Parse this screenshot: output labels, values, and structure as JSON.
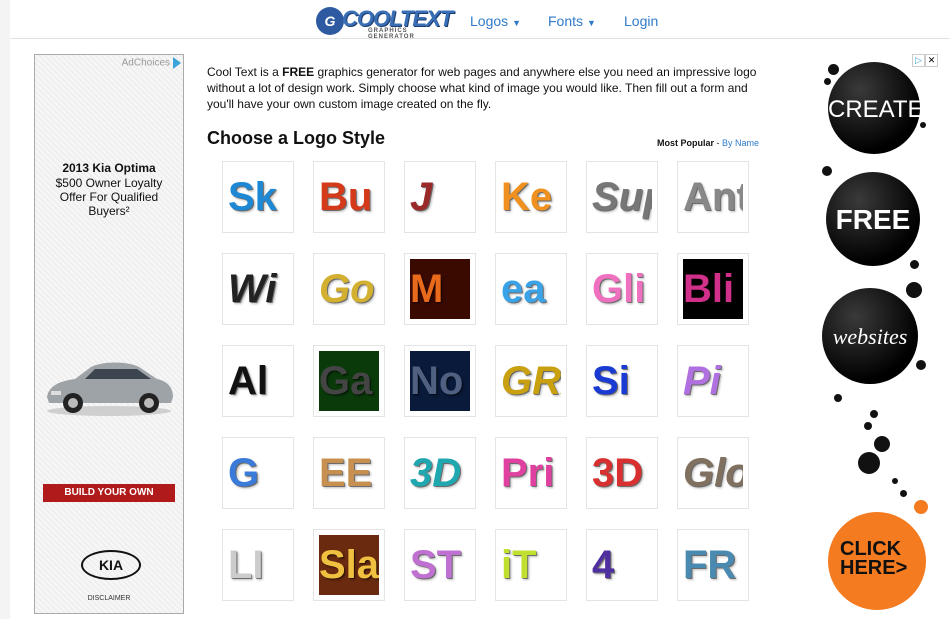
{
  "header": {
    "logo_text": "COOLTEXT",
    "logo_sub": "GRAPHICS GENERATOR",
    "logo_mark": "G",
    "nav": [
      {
        "label": "Logos",
        "dropdown": true
      },
      {
        "label": "Fonts",
        "dropdown": true
      },
      {
        "label": "Login",
        "dropdown": false
      }
    ]
  },
  "left_ad": {
    "adchoices": "AdChoices",
    "title": "2013 Kia Optima",
    "body_lines": [
      "$500 Owner Loyalty",
      "Offer For Qualified",
      "Buyers²"
    ],
    "button": "BUILD YOUR OWN",
    "brand": "KIA",
    "disclaimer": "DISCLAIMER"
  },
  "intro": {
    "before": "Cool Text is a ",
    "bold": "FREE",
    "after": " graphics generator for web pages and anywhere else you need an impressive logo without a lot of design work.  Simply choose what kind of image you would like. Then fill out a form and you'll have your own custom image created on the fly."
  },
  "section": {
    "title": "Choose a Logo Style",
    "sort_label": "Most Popular",
    "sort_sep": " - ",
    "sort_link": "By Name"
  },
  "logo_styles": [
    {
      "text": "Sk",
      "color": "#1e88d4",
      "bg": "#ffffff",
      "italic": false
    },
    {
      "text": "Bu",
      "color": "#d43a1a",
      "bg": "#ffffff",
      "italic": false
    },
    {
      "text": "J",
      "color": "#9a2a2a",
      "bg": "#ffffff",
      "italic": true
    },
    {
      "text": "Ke",
      "color": "#f0901e",
      "bg": "#ffffff",
      "italic": false
    },
    {
      "text": "Super",
      "color": "#777777",
      "bg": "#ffffff",
      "italic": true
    },
    {
      "text": "Ant",
      "color": "#888888",
      "bg": "#ffffff",
      "italic": false
    },
    {
      "text": "Wi",
      "color": "#222222",
      "bg": "#ffffff",
      "italic": true
    },
    {
      "text": "Go",
      "color": "#d4b030",
      "bg": "#ffffff",
      "italic": true
    },
    {
      "text": "M",
      "color": "#e86a1a",
      "bg": "#3a0a00",
      "italic": false
    },
    {
      "text": "ea",
      "color": "#3aa3e8",
      "bg": "#ffffff",
      "italic": false
    },
    {
      "text": "Gli",
      "color": "#f070c0",
      "bg": "#ffffff",
      "italic": false
    },
    {
      "text": "Bli",
      "color": "#d0308a",
      "bg": "#000000",
      "italic": false
    },
    {
      "text": "Al",
      "color": "#111111",
      "bg": "#ffffff",
      "italic": false
    },
    {
      "text": "Ga",
      "color": "#444444",
      "bg": "#0a3a0a",
      "italic": false
    },
    {
      "text": "No",
      "color": "#506080",
      "bg": "#0a1a3a",
      "italic": false
    },
    {
      "text": "GRA",
      "color": "#c8a010",
      "bg": "#ffffff",
      "italic": true
    },
    {
      "text": "Si",
      "color": "#1a3ad4",
      "bg": "#ffffff",
      "italic": false
    },
    {
      "text": "Pi",
      "color": "#b070e0",
      "bg": "#ffffff",
      "italic": true
    },
    {
      "text": "G",
      "color": "#3a7ad8",
      "bg": "#ffffff",
      "italic": false
    },
    {
      "text": "EE",
      "color": "#c89050",
      "bg": "#ffffff",
      "italic": false
    },
    {
      "text": "3D",
      "color": "#20a8b0",
      "bg": "#ffffff",
      "italic": true
    },
    {
      "text": "Pri",
      "color": "#e040a0",
      "bg": "#ffffff",
      "italic": false
    },
    {
      "text": "3D",
      "color": "#d83030",
      "bg": "#ffffff",
      "italic": false
    },
    {
      "text": "Glo",
      "color": "#807060",
      "bg": "#ffffff",
      "italic": true
    },
    {
      "text": "LI",
      "color": "#cccccc",
      "bg": "#ffffff",
      "italic": false
    },
    {
      "text": "Sla",
      "color": "#f0c040",
      "bg": "#6a2a10",
      "italic": false
    },
    {
      "text": "ST",
      "color": "#c070d0",
      "bg": "#ffffff",
      "italic": false
    },
    {
      "text": "iT",
      "color": "#c0e030",
      "bg": "#ffffff",
      "italic": false
    },
    {
      "text": "4",
      "color": "#5030a0",
      "bg": "#ffffff",
      "italic": false
    },
    {
      "text": "FR",
      "color": "#4a8ab0",
      "bg": "#ffffff",
      "italic": false
    }
  ],
  "right_ad": {
    "bubbles": [
      "CREATE",
      "FREE",
      "websites"
    ],
    "cta": "CLICK HERE>",
    "cta_color": "#f47b20"
  }
}
